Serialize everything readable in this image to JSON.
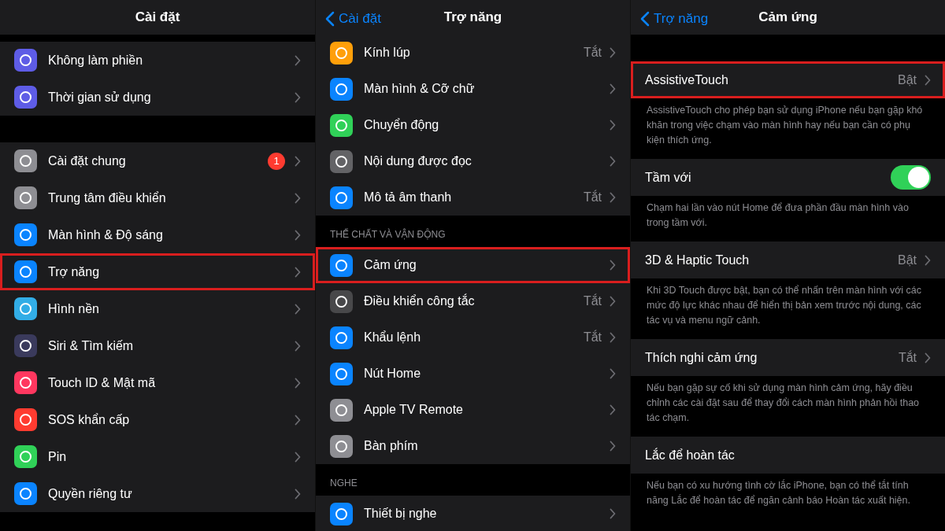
{
  "panels": [
    {
      "header": {
        "title": "Cài đặt"
      },
      "sections": [
        {
          "rows": [
            {
              "label": "Không làm phiền",
              "color": "#5e5ce6",
              "kind": "link",
              "highlighted": false
            },
            {
              "label": "Thời gian sử dụng",
              "color": "#5e5ce6",
              "kind": "link",
              "highlighted": false
            }
          ]
        },
        {
          "rows": [
            {
              "label": "Cài đặt chung",
              "color": "#8e8e93",
              "kind": "link",
              "badge": "1",
              "highlighted": false
            },
            {
              "label": "Trung tâm điều khiển",
              "color": "#8e8e93",
              "kind": "link",
              "highlighted": false
            },
            {
              "label": "Màn hình & Độ sáng",
              "color": "#0a84ff",
              "kind": "link",
              "highlighted": false
            },
            {
              "label": "Trợ năng",
              "color": "#0a84ff",
              "kind": "link",
              "highlighted": true
            },
            {
              "label": "Hình nền",
              "color": "#32ade6",
              "kind": "link",
              "highlighted": false
            },
            {
              "label": "Siri & Tìm kiếm",
              "color": "#3a3a5c",
              "kind": "link",
              "highlighted": false
            },
            {
              "label": "Touch ID & Mật mã",
              "color": "#ff375f",
              "kind": "link",
              "highlighted": false
            },
            {
              "label": "SOS khẩn cấp",
              "color": "#ff3b30",
              "kind": "link",
              "highlighted": false
            },
            {
              "label": "Pin",
              "color": "#30d158",
              "kind": "link",
              "highlighted": false
            },
            {
              "label": "Quyền riêng tư",
              "color": "#0a84ff",
              "kind": "link",
              "highlighted": false
            }
          ]
        }
      ]
    },
    {
      "header": {
        "back": "Cài đặt",
        "title": "Trợ năng"
      },
      "sections": [
        {
          "rows": [
            {
              "label": "Kính lúp",
              "value": "Tắt",
              "color": "#ff9f0a",
              "kind": "link",
              "highlighted": false
            },
            {
              "label": "Màn hình & Cỡ chữ",
              "color": "#0a84ff",
              "kind": "link",
              "highlighted": false
            },
            {
              "label": "Chuyển động",
              "color": "#30d158",
              "kind": "link",
              "highlighted": false
            },
            {
              "label": "Nội dung được đọc",
              "color": "#636366",
              "kind": "link",
              "highlighted": false
            },
            {
              "label": "Mô tả âm thanh",
              "value": "Tắt",
              "color": "#0a84ff",
              "kind": "link",
              "highlighted": false
            }
          ]
        },
        {
          "header": "THỂ CHẤT VÀ VẬN ĐỘNG",
          "rows": [
            {
              "label": "Cảm ứng",
              "color": "#0a84ff",
              "kind": "link",
              "highlighted": true
            },
            {
              "label": "Điều khiển công tắc",
              "value": "Tắt",
              "color": "#48484a",
              "kind": "link",
              "highlighted": false
            },
            {
              "label": "Khẩu lệnh",
              "value": "Tắt",
              "color": "#0a84ff",
              "kind": "link",
              "highlighted": false
            },
            {
              "label": "Nút Home",
              "color": "#0a84ff",
              "kind": "link",
              "highlighted": false
            },
            {
              "label": "Apple TV Remote",
              "color": "#8e8e93",
              "kind": "link",
              "highlighted": false
            },
            {
              "label": "Bàn phím",
              "color": "#8e8e93",
              "kind": "link",
              "highlighted": false
            }
          ]
        },
        {
          "header": "NGHE",
          "rows": [
            {
              "label": "Thiết bị nghe",
              "color": "#0a84ff",
              "kind": "link",
              "highlighted": false
            }
          ]
        }
      ]
    },
    {
      "header": {
        "back": "Trợ năng",
        "title": "Cảm ứng"
      },
      "sections": [
        {
          "rows": [
            {
              "label": "AssistiveTouch",
              "value": "Bật",
              "kind": "link",
              "highlighted": true
            }
          ],
          "footer": "AssistiveTouch cho phép bạn sử dụng iPhone nếu bạn gặp khó khăn trong việc chạm vào màn hình hay nếu bạn cần có phụ kiện thích ứng."
        },
        {
          "rows": [
            {
              "label": "Tầm với",
              "kind": "toggle",
              "on": true,
              "highlighted": false
            }
          ],
          "footer": "Chạm hai lần vào nút Home để đưa phần đầu màn hình vào trong tầm với."
        },
        {
          "rows": [
            {
              "label": "3D & Haptic Touch",
              "value": "Bật",
              "kind": "link",
              "highlighted": false
            }
          ],
          "footer": "Khi 3D Touch được bật, bạn có thể nhấn trên màn hình với các mức độ lực khác nhau để hiển thị bản xem trước nội dung, các tác vụ và menu ngữ cảnh."
        },
        {
          "rows": [
            {
              "label": "Thích nghi cảm ứng",
              "value": "Tắt",
              "kind": "link",
              "highlighted": false
            }
          ],
          "footer": "Nếu bạn gặp sự cố khi sử dụng màn hình cảm ứng, hãy điều chỉnh các cài đặt sau để thay đổi cách màn hình phản hồi thao tác chạm."
        },
        {
          "rows": [
            {
              "label": "Lắc để hoàn tác",
              "kind": "plain",
              "highlighted": false
            }
          ],
          "footer": "Nếu bạn có xu hướng tình cờ lắc iPhone, bạn có thể tắt tính năng Lắc để hoàn tác để ngăn cảnh báo Hoàn tác xuất hiện."
        }
      ]
    }
  ]
}
